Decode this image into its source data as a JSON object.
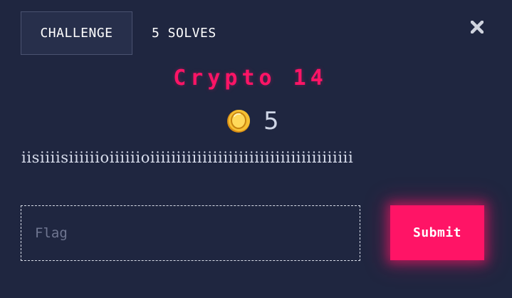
{
  "tabs": {
    "challenge": "CHALLENGE",
    "solves": "5 SOLVES"
  },
  "icons": {
    "close": "close-icon",
    "coin": "coin-icon"
  },
  "challenge": {
    "title": "Crypto 14",
    "points": "5",
    "description": "iisiiiisiiiiiioiiiiiioiiiiiiiiiiiiiiiiiiiiiiiiiiiiiiiiiiiiiii"
  },
  "form": {
    "flag_placeholder": "Flag",
    "flag_value": "",
    "submit_label": "Submit"
  },
  "colors": {
    "background": "#1f2640",
    "accent": "#ff1466",
    "coin": "#f5c033"
  }
}
